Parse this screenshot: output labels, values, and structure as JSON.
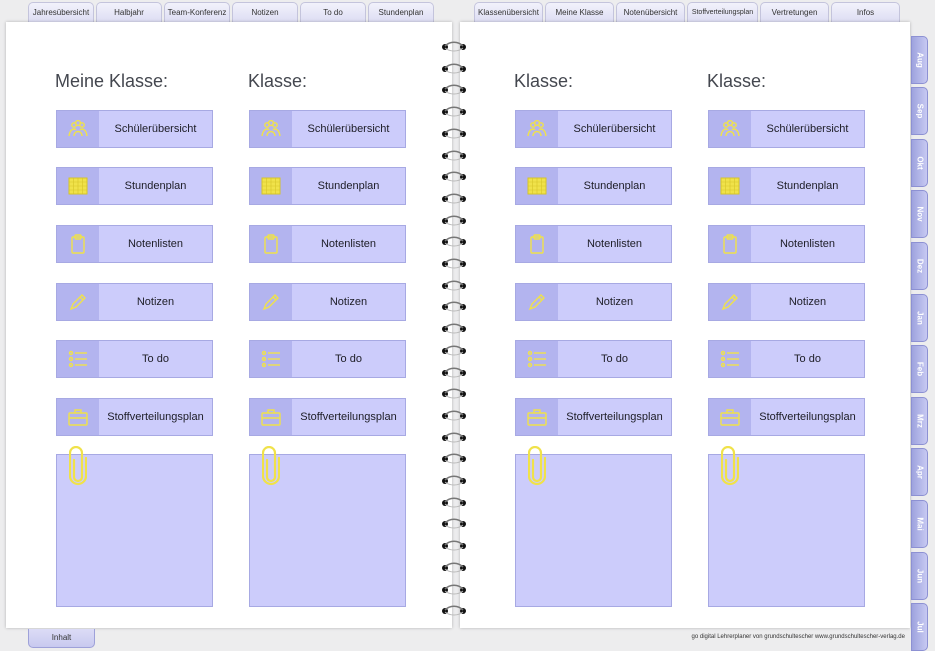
{
  "tabs_left": [
    "Jahresübersicht",
    "Halbjahr",
    "Team-Konferenz",
    "Notizen",
    "To do",
    "Stundenplan"
  ],
  "tabs_right": [
    "Klassenübersicht",
    "Meine Klasse",
    "Notenübersicht",
    "Stoffverteilungsplan",
    "Vertretungen",
    "Infos"
  ],
  "columns": [
    {
      "title": "Meine Klasse:"
    },
    {
      "title": "Klasse:"
    },
    {
      "title": "Klasse:"
    },
    {
      "title": "Klasse:"
    }
  ],
  "buttons": [
    {
      "label": "Schülerübersicht",
      "icon": "students-icon"
    },
    {
      "label": "Stundenplan",
      "icon": "timetable-icon"
    },
    {
      "label": "Notenlisten",
      "icon": "clipboard-icon"
    },
    {
      "label": "Notizen",
      "icon": "pencil-icon"
    },
    {
      "label": "To do",
      "icon": "checklist-icon"
    },
    {
      "label": "Stoffverteilungsplan",
      "icon": "briefcase-icon"
    }
  ],
  "months": [
    "Aug",
    "Sep",
    "Okt",
    "Nov",
    "Dez",
    "Jan",
    "Feb",
    "Mrz",
    "Apr",
    "Mai",
    "Jun",
    "Jul"
  ],
  "bottom_tab": "Inhalt",
  "footer": "go digital Lehrerplaner von grundschultescher www.grundschultescher-verlag.de",
  "colors": {
    "button_bg": "#ccccfb",
    "icon_bg": "#b3b4ef",
    "icon_color": "#f0e24a",
    "month_tab": "#9ea3de"
  }
}
